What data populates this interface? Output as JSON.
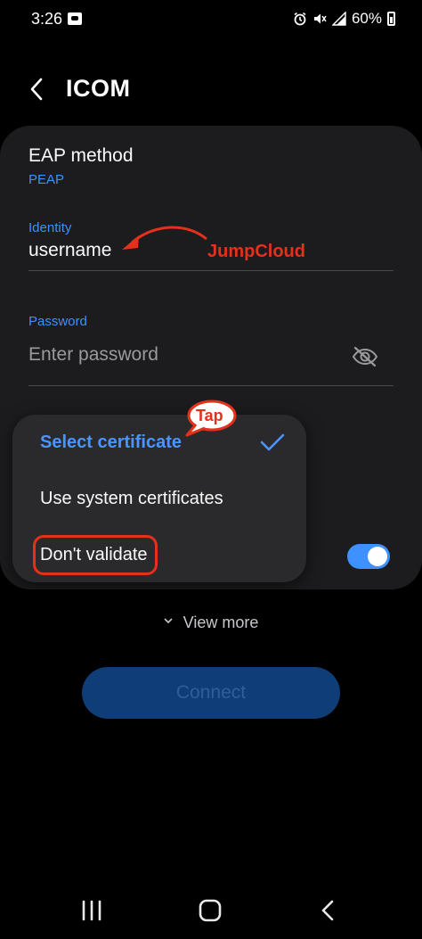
{
  "status_bar": {
    "time": "3:26",
    "battery": "60%",
    "icons": [
      "key-icon",
      "alarm-icon",
      "mute-icon",
      "signal-icon",
      "battery-icon"
    ]
  },
  "header": {
    "title": "ICOM",
    "back_icon": "back-arrow-icon"
  },
  "form": {
    "eap_method_label": "EAP method",
    "eap_method_value": "PEAP",
    "identity_label": "Identity",
    "identity_value": "username",
    "password_label": "Password",
    "password_placeholder": "Enter password",
    "password_visibility_icon": "eye-off-icon",
    "toggle_on": true
  },
  "certificate_menu": {
    "items": [
      {
        "label": "Select certificate",
        "selected": true
      },
      {
        "label": "Use system certificates",
        "selected": false
      },
      {
        "label": "Don't validate",
        "selected": false
      }
    ]
  },
  "annotations": {
    "identity_note": "JumpCloud",
    "tap_note": "Tap",
    "color": "#e5301b"
  },
  "actions": {
    "view_more": "View more",
    "connect": "Connect"
  },
  "nav_bar": {
    "icons": [
      "recent-apps-icon",
      "home-icon",
      "back-icon"
    ]
  },
  "colors": {
    "accent": "#3e91ff",
    "background": "#000000",
    "card": "#1c1c1e",
    "popup": "#2a2a2c",
    "connect_button": "#0f3d77"
  }
}
